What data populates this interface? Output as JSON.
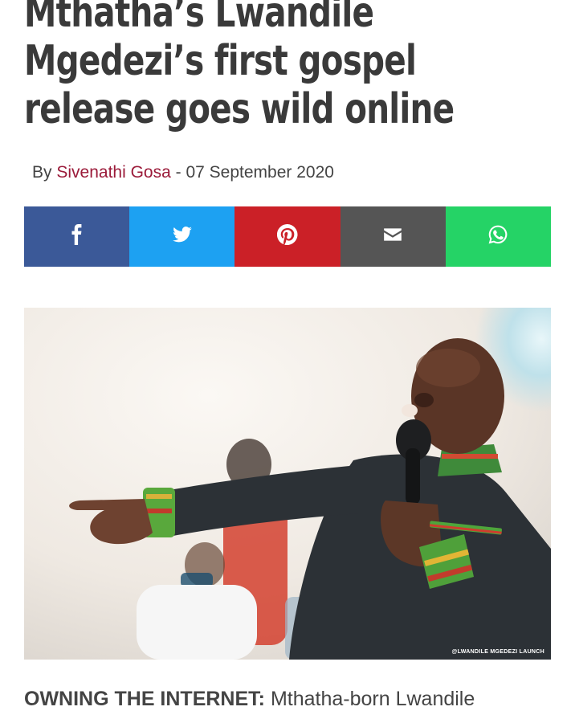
{
  "article": {
    "headline_line1": "Mthatha’s Lwandile",
    "headline_line2": "Mgedezi’s first gospel",
    "headline_line3": "release goes wild online",
    "by_prefix": "By",
    "author": "Sivenathi Gosa",
    "date_sep": " - ",
    "date": "07 September 2020",
    "photo_credit": "@LWANDILE MGEDEZI LAUNCH",
    "lead_kicker": "OWNING THE INTERNET:",
    "lead_text": " Mthatha-born Lwandile"
  },
  "share": {
    "buttons": [
      {
        "network": "facebook",
        "icon": "facebook-icon",
        "color": "#3b5998"
      },
      {
        "network": "twitter",
        "icon": "twitter-icon",
        "color": "#1da1f2"
      },
      {
        "network": "pinterest",
        "icon": "pinterest-icon",
        "color": "#cb2027"
      },
      {
        "network": "email",
        "icon": "email-icon",
        "color": "#555555"
      },
      {
        "network": "whatsapp",
        "icon": "whatsapp-icon",
        "color": "#25d366"
      }
    ]
  },
  "colors": {
    "author_link": "#9b1b3a",
    "headline": "#3a3a3a"
  }
}
